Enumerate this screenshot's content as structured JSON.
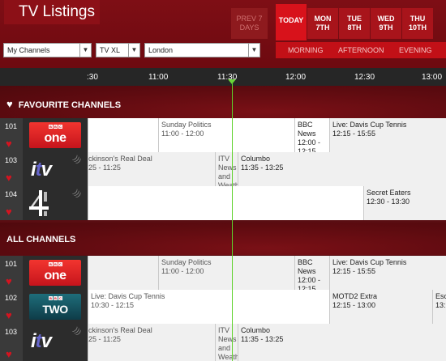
{
  "header": {
    "title": "TV Listings",
    "prev": "PREV 7\nDAYS",
    "days": [
      {
        "label": "TODAY",
        "sub": ""
      },
      {
        "label": "MON",
        "sub": "7TH"
      },
      {
        "label": "TUE",
        "sub": "8TH"
      },
      {
        "label": "WED",
        "sub": "9TH"
      },
      {
        "label": "THU",
        "sub": "10TH"
      }
    ],
    "dayparts": [
      "MORNING",
      "AFTERNOON",
      "EVENING"
    ],
    "filters": {
      "channels": "My Channels",
      "package": "TV XL",
      "region": "London"
    }
  },
  "timebar": {
    "ticks": [
      ":30",
      "11:00",
      "11:30",
      "12:00",
      "12:30",
      "13:00"
    ]
  },
  "sections": {
    "favourite": "FAVOURITE CHANNELS",
    "all": "ALL CHANNELS"
  },
  "rows": [
    {
      "num": "101",
      "logo": "BBC one",
      "progs": [
        {
          "title": "",
          "time": ""
        },
        {
          "title": "Sunday Politics",
          "time": "11:00 - 12:00"
        },
        {
          "title": "BBC News",
          "time": "12:00 - 12:15"
        },
        {
          "title": "Live: Davis Cup Tennis",
          "time": "12:15 - 15:55"
        }
      ]
    },
    {
      "num": "103",
      "logo": "itv",
      "progs": [
        {
          "title": "ckinson's Real Deal",
          "time": "25 - 11:25"
        },
        {
          "title": "ITV News and Weath",
          "time": ""
        },
        {
          "title": "Columbo",
          "time": "11:35 - 13:25"
        }
      ]
    },
    {
      "num": "104",
      "logo": "Channel 4",
      "progs": [
        {
          "title": "",
          "time": ""
        },
        {
          "title": "Secret Eaters",
          "time": "12:30 - 13:30"
        }
      ]
    },
    {
      "num": "101",
      "logo": "BBC one",
      "progs": [
        {
          "title": "",
          "time": ""
        },
        {
          "title": "Sunday Politics",
          "time": "11:00 - 12:00"
        },
        {
          "title": "BBC News",
          "time": "12:00 - 12:15"
        },
        {
          "title": "Live: Davis Cup Tennis",
          "time": "12:15 - 15:55"
        }
      ]
    },
    {
      "num": "102",
      "logo": "BBC TWO",
      "progs": [
        {
          "title": "Live: Davis Cup Tennis",
          "time": "10:30 - 12:15"
        },
        {
          "title": "MOTD2 Extra",
          "time": "12:15 - 13:00"
        },
        {
          "title": "Esc",
          "time": "13:"
        }
      ]
    },
    {
      "num": "103",
      "logo": "itv",
      "progs": [
        {
          "title": "ckinson's Real Deal",
          "time": "25 - 11:25"
        },
        {
          "title": "ITV News and Weath",
          "time": ""
        },
        {
          "title": "Columbo",
          "time": "11:35 - 13:25"
        }
      ]
    }
  ]
}
